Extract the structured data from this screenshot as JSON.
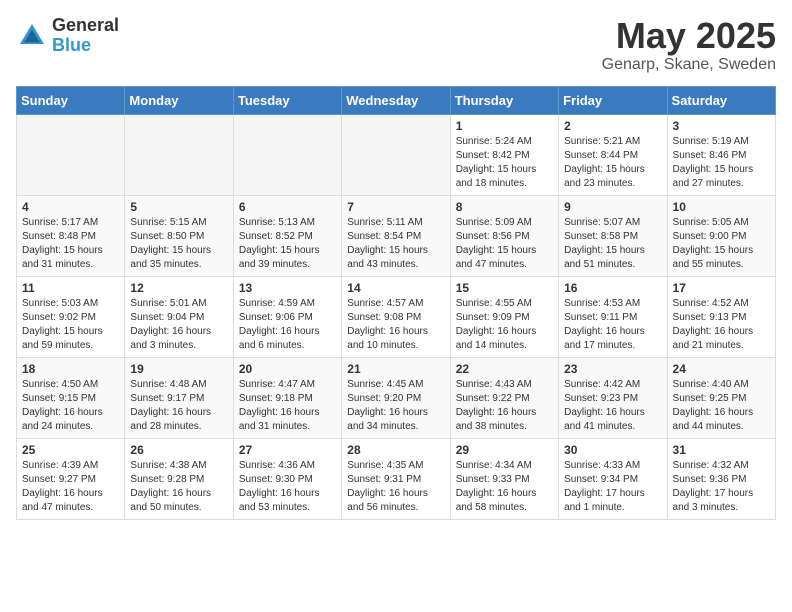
{
  "logo": {
    "general": "General",
    "blue": "Blue"
  },
  "title": "May 2025",
  "location": "Genarp, Skane, Sweden",
  "weekdays": [
    "Sunday",
    "Monday",
    "Tuesday",
    "Wednesday",
    "Thursday",
    "Friday",
    "Saturday"
  ],
  "weeks": [
    [
      {
        "day": "",
        "info": ""
      },
      {
        "day": "",
        "info": ""
      },
      {
        "day": "",
        "info": ""
      },
      {
        "day": "",
        "info": ""
      },
      {
        "day": "1",
        "info": "Sunrise: 5:24 AM\nSunset: 8:42 PM\nDaylight: 15 hours\nand 18 minutes."
      },
      {
        "day": "2",
        "info": "Sunrise: 5:21 AM\nSunset: 8:44 PM\nDaylight: 15 hours\nand 23 minutes."
      },
      {
        "day": "3",
        "info": "Sunrise: 5:19 AM\nSunset: 8:46 PM\nDaylight: 15 hours\nand 27 minutes."
      }
    ],
    [
      {
        "day": "4",
        "info": "Sunrise: 5:17 AM\nSunset: 8:48 PM\nDaylight: 15 hours\nand 31 minutes."
      },
      {
        "day": "5",
        "info": "Sunrise: 5:15 AM\nSunset: 8:50 PM\nDaylight: 15 hours\nand 35 minutes."
      },
      {
        "day": "6",
        "info": "Sunrise: 5:13 AM\nSunset: 8:52 PM\nDaylight: 15 hours\nand 39 minutes."
      },
      {
        "day": "7",
        "info": "Sunrise: 5:11 AM\nSunset: 8:54 PM\nDaylight: 15 hours\nand 43 minutes."
      },
      {
        "day": "8",
        "info": "Sunrise: 5:09 AM\nSunset: 8:56 PM\nDaylight: 15 hours\nand 47 minutes."
      },
      {
        "day": "9",
        "info": "Sunrise: 5:07 AM\nSunset: 8:58 PM\nDaylight: 15 hours\nand 51 minutes."
      },
      {
        "day": "10",
        "info": "Sunrise: 5:05 AM\nSunset: 9:00 PM\nDaylight: 15 hours\nand 55 minutes."
      }
    ],
    [
      {
        "day": "11",
        "info": "Sunrise: 5:03 AM\nSunset: 9:02 PM\nDaylight: 15 hours\nand 59 minutes."
      },
      {
        "day": "12",
        "info": "Sunrise: 5:01 AM\nSunset: 9:04 PM\nDaylight: 16 hours\nand 3 minutes."
      },
      {
        "day": "13",
        "info": "Sunrise: 4:59 AM\nSunset: 9:06 PM\nDaylight: 16 hours\nand 6 minutes."
      },
      {
        "day": "14",
        "info": "Sunrise: 4:57 AM\nSunset: 9:08 PM\nDaylight: 16 hours\nand 10 minutes."
      },
      {
        "day": "15",
        "info": "Sunrise: 4:55 AM\nSunset: 9:09 PM\nDaylight: 16 hours\nand 14 minutes."
      },
      {
        "day": "16",
        "info": "Sunrise: 4:53 AM\nSunset: 9:11 PM\nDaylight: 16 hours\nand 17 minutes."
      },
      {
        "day": "17",
        "info": "Sunrise: 4:52 AM\nSunset: 9:13 PM\nDaylight: 16 hours\nand 21 minutes."
      }
    ],
    [
      {
        "day": "18",
        "info": "Sunrise: 4:50 AM\nSunset: 9:15 PM\nDaylight: 16 hours\nand 24 minutes."
      },
      {
        "day": "19",
        "info": "Sunrise: 4:48 AM\nSunset: 9:17 PM\nDaylight: 16 hours\nand 28 minutes."
      },
      {
        "day": "20",
        "info": "Sunrise: 4:47 AM\nSunset: 9:18 PM\nDaylight: 16 hours\nand 31 minutes."
      },
      {
        "day": "21",
        "info": "Sunrise: 4:45 AM\nSunset: 9:20 PM\nDaylight: 16 hours\nand 34 minutes."
      },
      {
        "day": "22",
        "info": "Sunrise: 4:43 AM\nSunset: 9:22 PM\nDaylight: 16 hours\nand 38 minutes."
      },
      {
        "day": "23",
        "info": "Sunrise: 4:42 AM\nSunset: 9:23 PM\nDaylight: 16 hours\nand 41 minutes."
      },
      {
        "day": "24",
        "info": "Sunrise: 4:40 AM\nSunset: 9:25 PM\nDaylight: 16 hours\nand 44 minutes."
      }
    ],
    [
      {
        "day": "25",
        "info": "Sunrise: 4:39 AM\nSunset: 9:27 PM\nDaylight: 16 hours\nand 47 minutes."
      },
      {
        "day": "26",
        "info": "Sunrise: 4:38 AM\nSunset: 9:28 PM\nDaylight: 16 hours\nand 50 minutes."
      },
      {
        "day": "27",
        "info": "Sunrise: 4:36 AM\nSunset: 9:30 PM\nDaylight: 16 hours\nand 53 minutes."
      },
      {
        "day": "28",
        "info": "Sunrise: 4:35 AM\nSunset: 9:31 PM\nDaylight: 16 hours\nand 56 minutes."
      },
      {
        "day": "29",
        "info": "Sunrise: 4:34 AM\nSunset: 9:33 PM\nDaylight: 16 hours\nand 58 minutes."
      },
      {
        "day": "30",
        "info": "Sunrise: 4:33 AM\nSunset: 9:34 PM\nDaylight: 17 hours\nand 1 minute."
      },
      {
        "day": "31",
        "info": "Sunrise: 4:32 AM\nSunset: 9:36 PM\nDaylight: 17 hours\nand 3 minutes."
      }
    ]
  ]
}
